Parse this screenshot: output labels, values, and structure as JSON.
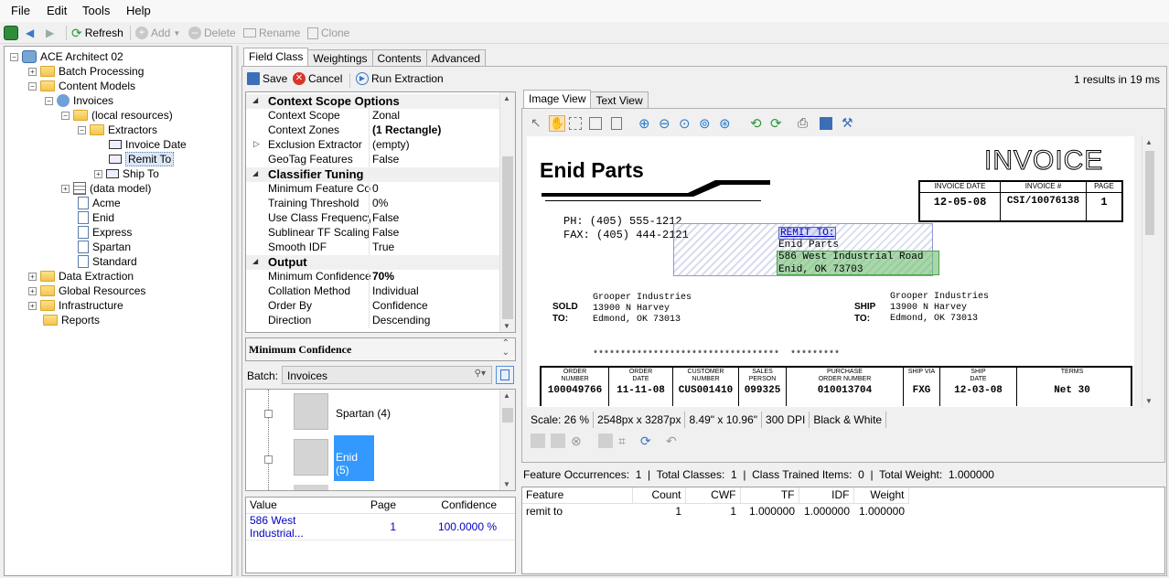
{
  "menu": [
    "File",
    "Edit",
    "Tools",
    "Help"
  ],
  "toolbar": {
    "refresh": "Refresh",
    "add": "Add",
    "delete": "Delete",
    "rename": "Rename",
    "clone": "Clone"
  },
  "tree": [
    {
      "label": "ACE Architect 02"
    },
    {
      "label": "Batch Processing"
    },
    {
      "label": "Content Models"
    },
    {
      "label": "Invoices"
    },
    {
      "label": "(local resources)"
    },
    {
      "label": "Extractors"
    },
    {
      "label": "Invoice Date"
    },
    {
      "label": "Remit To"
    },
    {
      "label": "Ship To"
    },
    {
      "label": "(data model)"
    },
    {
      "label": "Acme"
    },
    {
      "label": "Enid"
    },
    {
      "label": "Express"
    },
    {
      "label": "Spartan"
    },
    {
      "label": "Standard"
    },
    {
      "label": "Data Extraction"
    },
    {
      "label": "Global Resources"
    },
    {
      "label": "Infrastructure"
    },
    {
      "label": "Reports"
    }
  ],
  "main_tabs": [
    "Field Class",
    "Weightings",
    "Contents",
    "Advanced"
  ],
  "actions": {
    "save": "Save",
    "cancel": "Cancel",
    "run": "Run Extraction"
  },
  "results_info": "1 results in 19 ms",
  "props": [
    {
      "cat": "Context Scope Options"
    },
    {
      "k": "Context Scope",
      "v": "Zonal"
    },
    {
      "k": "Context Zones",
      "v": "(1 Rectangle)",
      "bold": true
    },
    {
      "k": "Exclusion Extractor",
      "v": "(empty)",
      "arrow": true
    },
    {
      "k": "GeoTag Features",
      "v": "False"
    },
    {
      "cat": "Classifier Tuning"
    },
    {
      "k": "Minimum Feature Count",
      "v": "0"
    },
    {
      "k": "Training Threshold",
      "v": "0%"
    },
    {
      "k": "Use Class Frequency",
      "v": "False"
    },
    {
      "k": "Sublinear TF Scaling",
      "v": "False"
    },
    {
      "k": "Smooth IDF",
      "v": "True"
    },
    {
      "cat": "Output"
    },
    {
      "k": "Minimum Confidence",
      "v": "70%",
      "bold": true
    },
    {
      "k": "Collation Method",
      "v": "Individual"
    },
    {
      "k": "Order By",
      "v": "Confidence"
    },
    {
      "k": "Direction",
      "v": "Descending"
    }
  ],
  "desc_title": "Minimum Confidence",
  "batch": {
    "label": "Batch:",
    "value": "Invoices"
  },
  "batch_items": [
    "Spartan (4)",
    "Enid (5)"
  ],
  "results": {
    "headers": [
      "Value",
      "Page",
      "Confidence"
    ],
    "rows": [
      [
        "586 West Industrial...",
        "1",
        "100.0000 %"
      ]
    ]
  },
  "view_tabs": [
    "Image View",
    "Text View"
  ],
  "invoice": {
    "company": "Enid Parts",
    "title": "INVOICE",
    "hdr_labels": [
      "INVOICE DATE",
      "INVOICE #",
      "PAGE"
    ],
    "hdr_values": [
      "12-05-08",
      "CSI/10076138",
      "1"
    ],
    "ph": "PH:  (405) 555-1212",
    "fax": "FAX: (405) 444-2121",
    "remit_label": "REMIT TO:",
    "remit_lines": [
      "Enid Parts",
      "586 West Industrial Road",
      "Enid, OK 73703"
    ],
    "sold_label": "SOLD\nTO:",
    "ship_label": "SHIP\nTO:",
    "sold_lines": [
      "Grooper Industries",
      "13900 N Harvey",
      "Edmond, OK 73013"
    ],
    "ship_lines": [
      "Grooper Industries",
      "13900 N Harvey",
      "Edmond, OK 73013"
    ],
    "stars": "**********************************  *********",
    "cols": [
      "ORDER\nNUMBER",
      "ORDER\nDATE",
      "CUSTOMER\nNUMBER",
      "SALES\nPERSON",
      "PURCHASE\nORDER NUMBER",
      "SHIP VIA",
      "SHIP\nDATE",
      "TERMS"
    ],
    "vals": [
      "100049766",
      "11-11-08",
      "CUS001410",
      "099325",
      "010013704",
      "FXG",
      "12-03-08",
      "Net 30"
    ]
  },
  "image_status": [
    "Scale: 26 %",
    "2548px x 3287px",
    "8.49\" x 10.96\"",
    "300 DPI",
    "Black & White"
  ],
  "stats": "Feature Occurrences:  1  |  Total Classes:  1  |  Class Trained Items:  0  |  Total Weight:  1.000000",
  "features": {
    "headers": [
      "Feature",
      "Count",
      "CWF",
      "TF",
      "IDF",
      "Weight"
    ],
    "rows": [
      [
        "remit to",
        "1",
        "1",
        "1.000000",
        "1.000000",
        "1.000000"
      ]
    ]
  },
  "colors": {
    "accent": "#3399ff",
    "remit_box": "#9aa6d6",
    "green_box": "#70c070",
    "link": "#0000c0"
  }
}
